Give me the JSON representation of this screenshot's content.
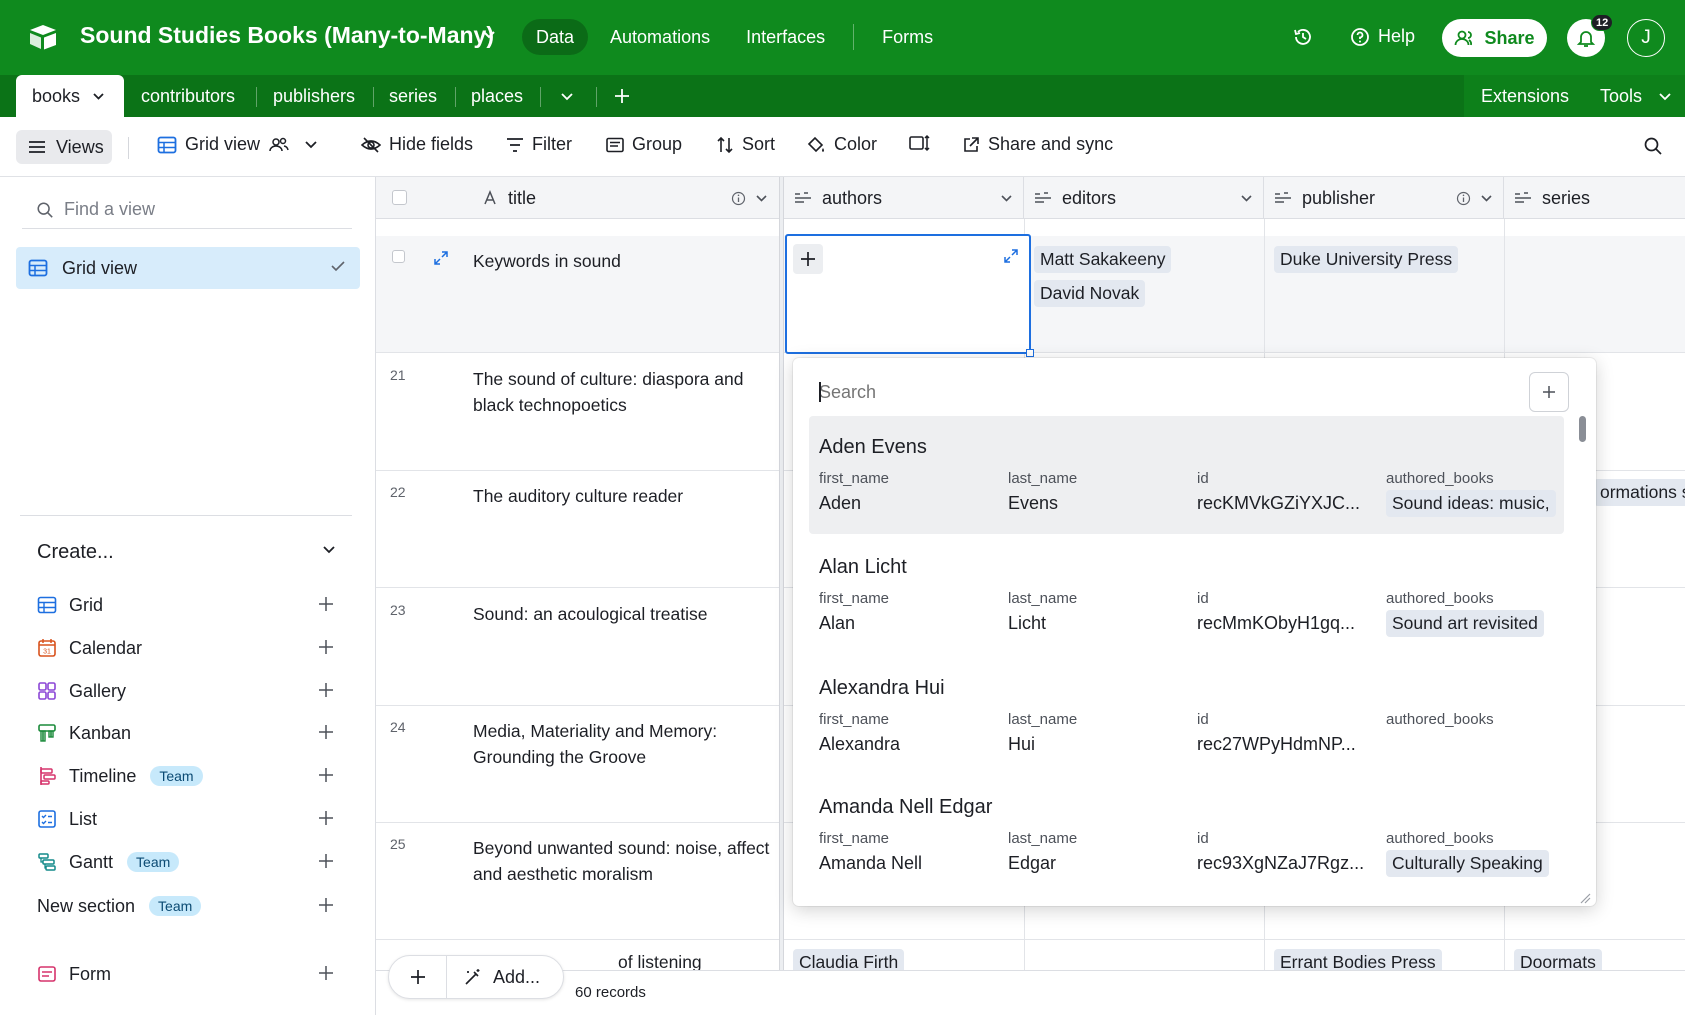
{
  "app": {
    "base_title": "Sound Studies Books (Many-to-Many)",
    "nav": [
      "Data",
      "Automations",
      "Interfaces",
      "Forms"
    ],
    "help": "Help",
    "share": "Share",
    "notification_count": "12",
    "user_initial": "J",
    "brand_color": "#0f8a1e"
  },
  "tables": {
    "active": "books",
    "others": [
      "contributors",
      "publishers",
      "series",
      "places"
    ],
    "right": [
      "Extensions",
      "Tools"
    ]
  },
  "toolbar": {
    "views": "Views",
    "view_name": "Grid view",
    "hide_fields": "Hide fields",
    "filter": "Filter",
    "group": "Group",
    "sort": "Sort",
    "color": "Color",
    "share_sync": "Share and sync"
  },
  "sidebar": {
    "find_placeholder": "Find a view",
    "current_view": "Grid view",
    "create_title": "Create...",
    "create_items": [
      {
        "label": "Grid",
        "icon": "grid-icon",
        "color": "#1d6fe0"
      },
      {
        "label": "Calendar",
        "icon": "calendar-icon",
        "color": "#d9531e",
        "icon_text": "31"
      },
      {
        "label": "Gallery",
        "icon": "gallery-icon",
        "color": "#8b46d6"
      },
      {
        "label": "Kanban",
        "icon": "kanban-icon",
        "color": "#1a8a3a"
      },
      {
        "label": "Timeline",
        "icon": "timeline-icon",
        "color": "#d6336c",
        "badge": "Team"
      },
      {
        "label": "List",
        "icon": "list-icon",
        "color": "#1d6fe0"
      },
      {
        "label": "Gantt",
        "icon": "gantt-icon",
        "color": "#138a8a",
        "badge": "Team"
      },
      {
        "label": "New section",
        "icon": "",
        "badge": "Team"
      },
      {
        "label": "Form",
        "icon": "form-icon",
        "color": "#d6336c"
      }
    ]
  },
  "grid": {
    "columns": [
      "title",
      "authors",
      "editors",
      "publisher",
      "series"
    ],
    "rows": [
      {
        "num": "",
        "title": "Keywords in sound",
        "editors": [
          "Matt Sakakeeny",
          "David Novak"
        ],
        "publisher": "Duke University Press"
      },
      {
        "num": "21",
        "title": "The sound of culture: diaspora and black technopoetics"
      },
      {
        "num": "22",
        "title": "The auditory culture reader",
        "series_partial": "ormations s"
      },
      {
        "num": "23",
        "title": "Sound: an acoulogical treatise"
      },
      {
        "num": "24",
        "title": "Media, Materiality and Memory: Grounding the Groove"
      },
      {
        "num": "25",
        "title": "Beyond unwanted sound: noise, affect and aesthetic moralism"
      },
      {
        "num": "",
        "title": "of listening",
        "authors": "Claudia Firth",
        "publisher": "Errant Bodies Press",
        "series": "Doormats"
      }
    ],
    "add_label": "Add...",
    "records": "60 records"
  },
  "popup": {
    "search_placeholder": "Search",
    "field_labels": [
      "first_name",
      "last_name",
      "id",
      "authored_books"
    ],
    "records": [
      {
        "name": "Aden Evens",
        "first_name": "Aden",
        "last_name": "Evens",
        "id": "recKMVkGZiYXJC...",
        "book": "Sound ideas: music,"
      },
      {
        "name": "Alan Licht",
        "first_name": "Alan",
        "last_name": "Licht",
        "id": "recMmKObyH1gq...",
        "book": "Sound art revisited"
      },
      {
        "name": "Alexandra Hui",
        "first_name": "Alexandra",
        "last_name": "Hui",
        "id": "rec27WPyHdmNP...",
        "book": ""
      },
      {
        "name": "Amanda Nell Edgar",
        "first_name": "Amanda Nell",
        "last_name": "Edgar",
        "id": "rec93XgNZaJ7Rgz...",
        "book": "Culturally Speaking"
      }
    ]
  }
}
